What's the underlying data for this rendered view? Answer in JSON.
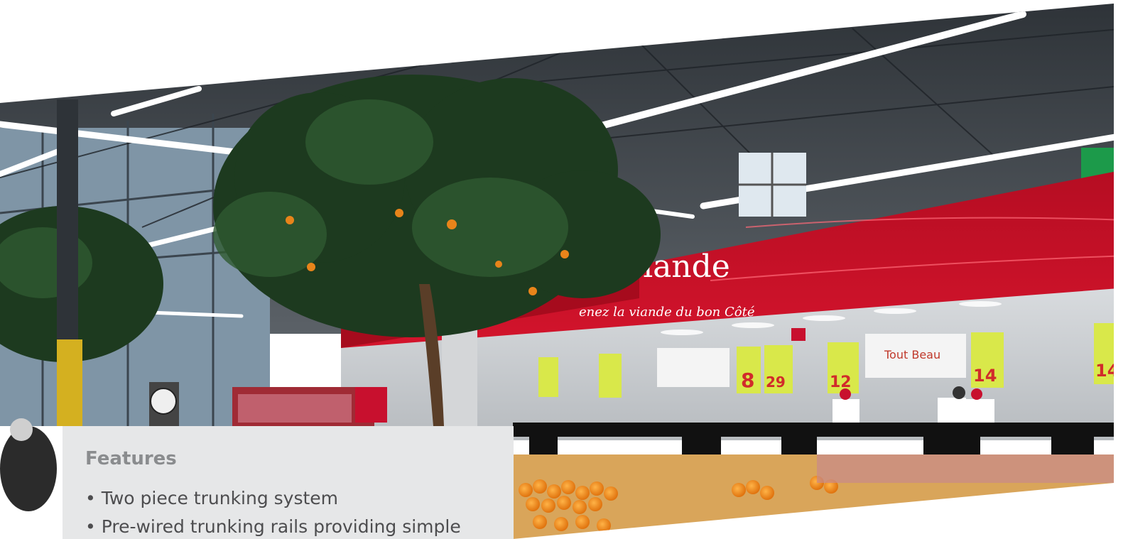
{
  "photo": {
    "description_icon": "supermarket-photo",
    "sign_main": "iande",
    "sign_sub": "enez la viande du bon Côté",
    "price_tags": [
      "8",
      "29",
      "12",
      "14",
      "14"
    ],
    "colors": {
      "banner_red": "#c8102e",
      "ceiling": "#3a3f45",
      "tag_yellow": "#d9e84a",
      "oranges": "#f08a1c"
    }
  },
  "features": {
    "title": "Features",
    "items": [
      "Two piece trunking system",
      "Pre-wired trunking rails providing simple"
    ]
  }
}
